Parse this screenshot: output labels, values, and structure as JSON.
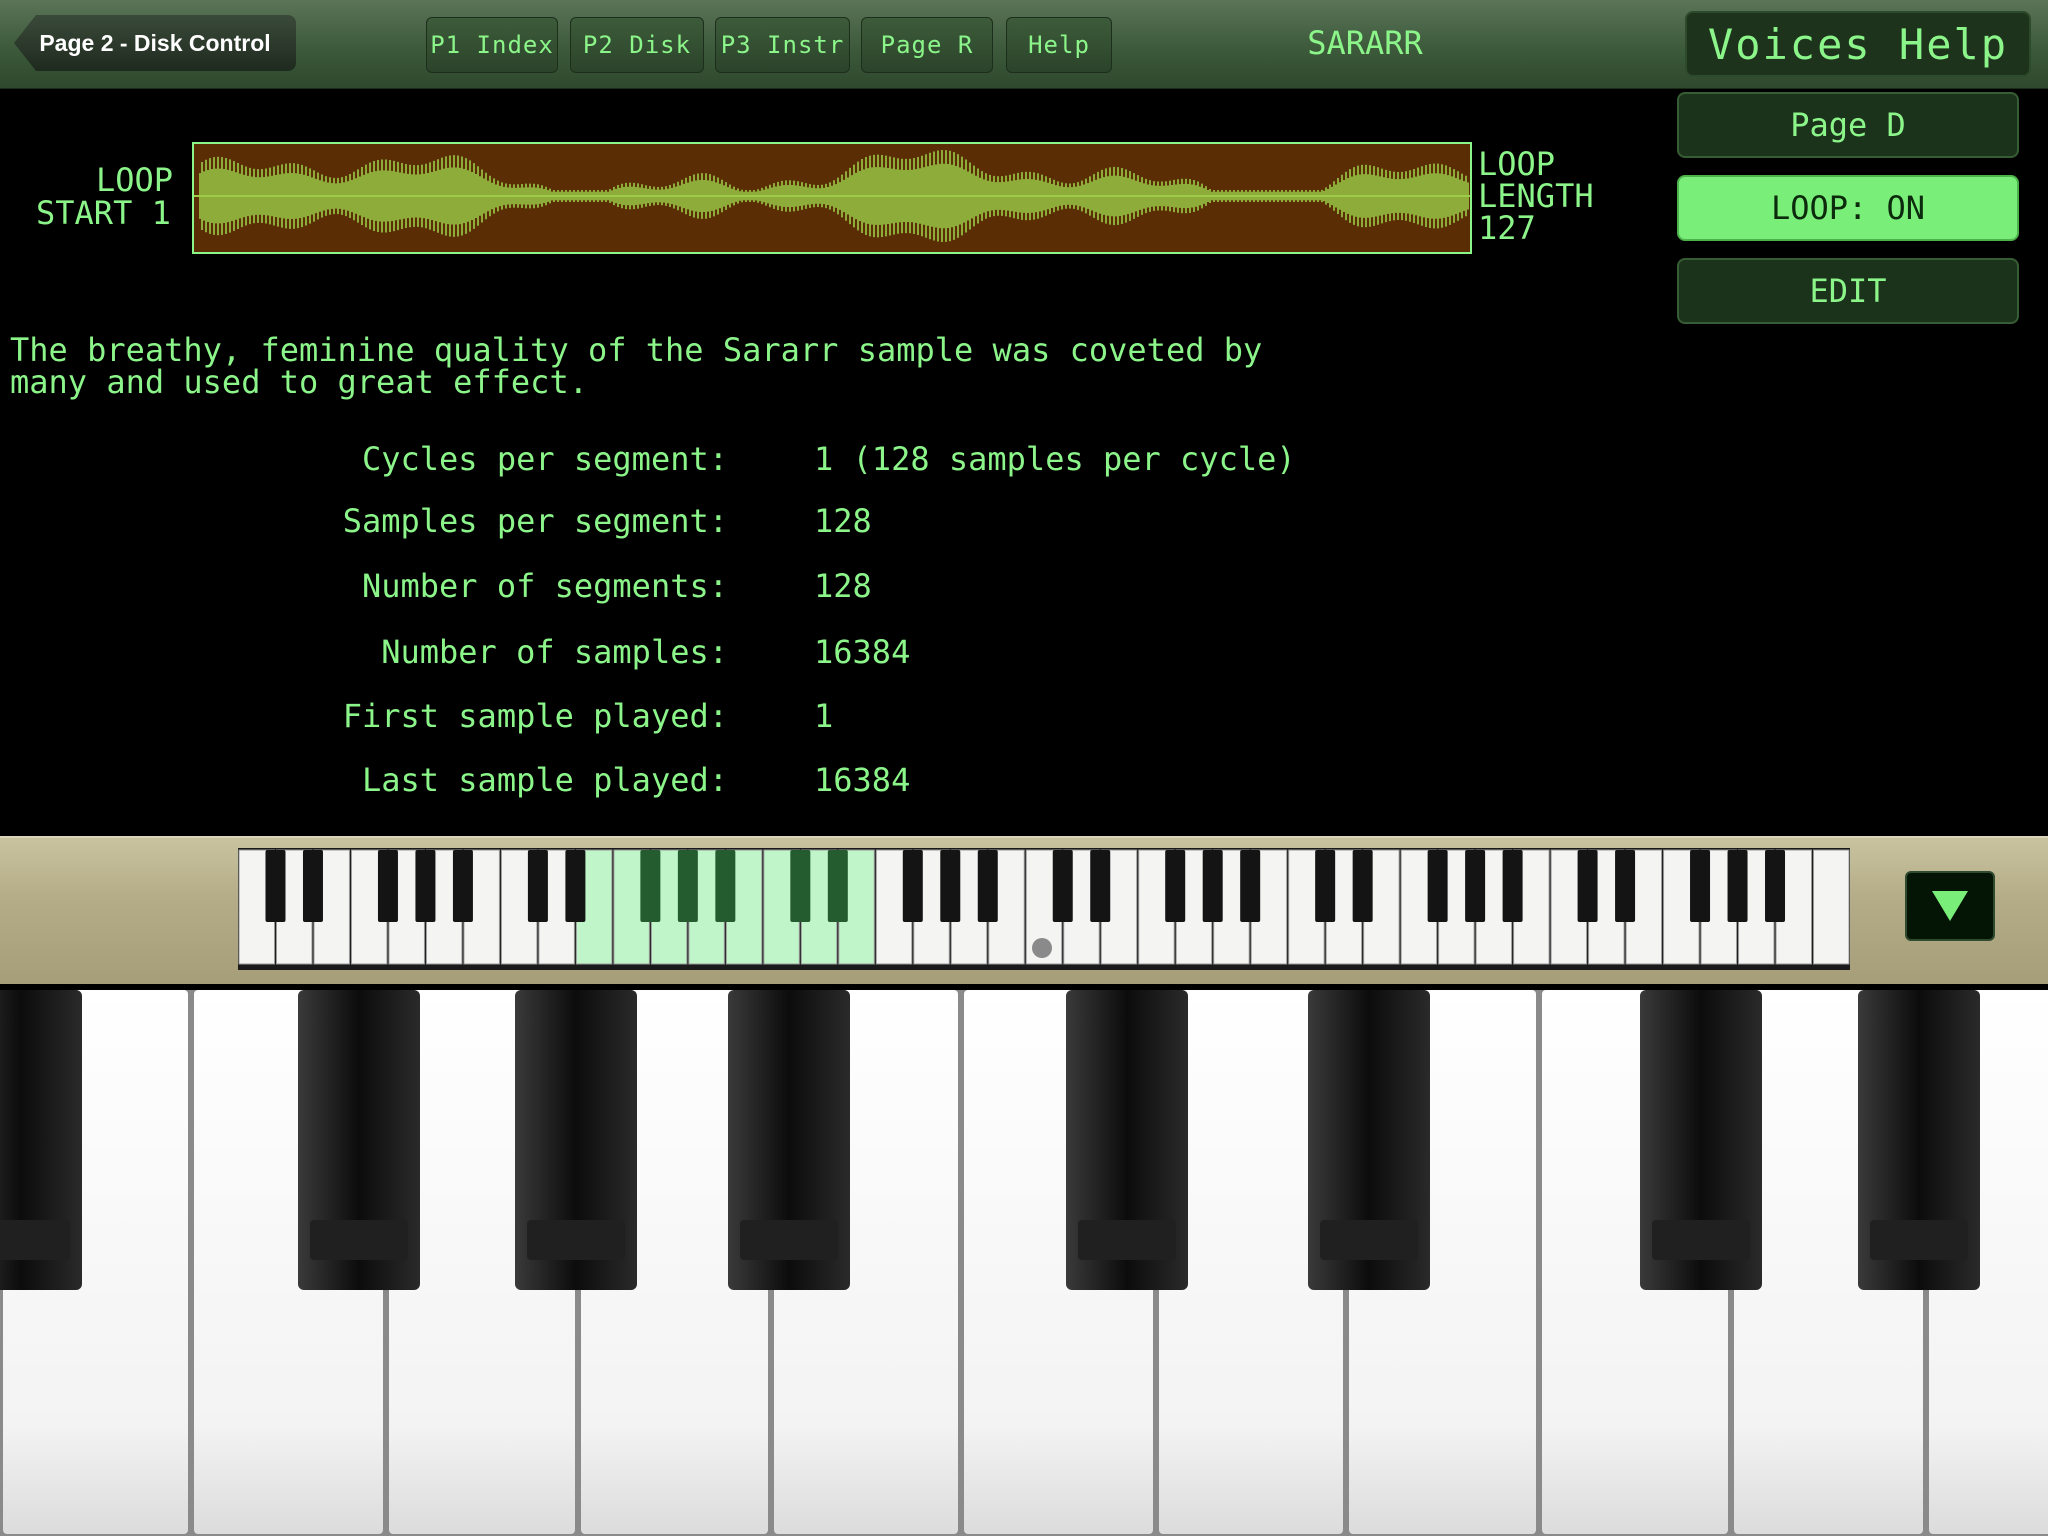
{
  "header": {
    "back_label": "Page 2 - Disk Control",
    "tabs": [
      {
        "label": "P1 Index"
      },
      {
        "label": "P2 Disk"
      },
      {
        "label": "P3 Instr"
      },
      {
        "label": "Page R"
      },
      {
        "label": "Help"
      }
    ],
    "title": "SARARR",
    "voices_help_label": "Voices Help"
  },
  "side_buttons": {
    "page_d_label": "Page D",
    "loop_label": "LOOP: ON",
    "edit_label": "EDIT"
  },
  "loop": {
    "start_line1": "LOOP",
    "start_line2": "START 1",
    "length_line1": "LOOP",
    "length_line2": "LENGTH",
    "length_line3": "127"
  },
  "description": "The breathy, feminine quality of the Sararr sample was coveted by\nmany and used to great effect.",
  "stats": [
    {
      "label": "Cycles per segment:",
      "value": "1 (128 samples per cycle)"
    },
    {
      "label": "Samples per segment:",
      "value": "128"
    },
    {
      "label": "Number of segments:",
      "value": "128"
    },
    {
      "label": "Number of samples:",
      "value": "16384"
    },
    {
      "label": "First sample played:",
      "value": "1"
    },
    {
      "label": "Last sample played:",
      "value": "16384"
    }
  ],
  "colors": {
    "accent": "#8cf58a",
    "loop_on": "#79ef79",
    "waveform_bg": "#5a2d05",
    "waveform": "#9ccc48",
    "highlight_keys": "#bff5c8"
  },
  "icons": {
    "collapse": "triangle-down-icon"
  }
}
